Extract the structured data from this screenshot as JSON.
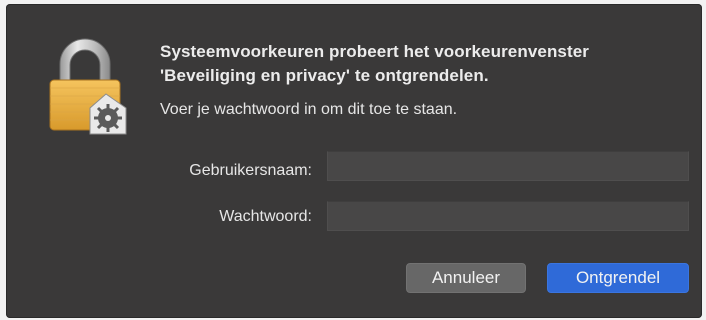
{
  "dialog": {
    "title_line1": "Systeemvoorkeuren probeert het voorkeurenvenster",
    "title_line2": "'Beveiliging en privacy' te ontgrendelen.",
    "subtitle": "Voer je wachtwoord in om dit toe te staan.",
    "icon": "padlock-icon",
    "colors": {
      "background": "#3a3939",
      "accent": "#2f6ad8",
      "secondary_button": "#676767"
    }
  },
  "form": {
    "username_label": "Gebruikersnaam:",
    "username_value": "",
    "password_label": "Wachtwoord:",
    "password_value": ""
  },
  "buttons": {
    "cancel_label": "Annuleer",
    "unlock_label": "Ontgrendel"
  }
}
